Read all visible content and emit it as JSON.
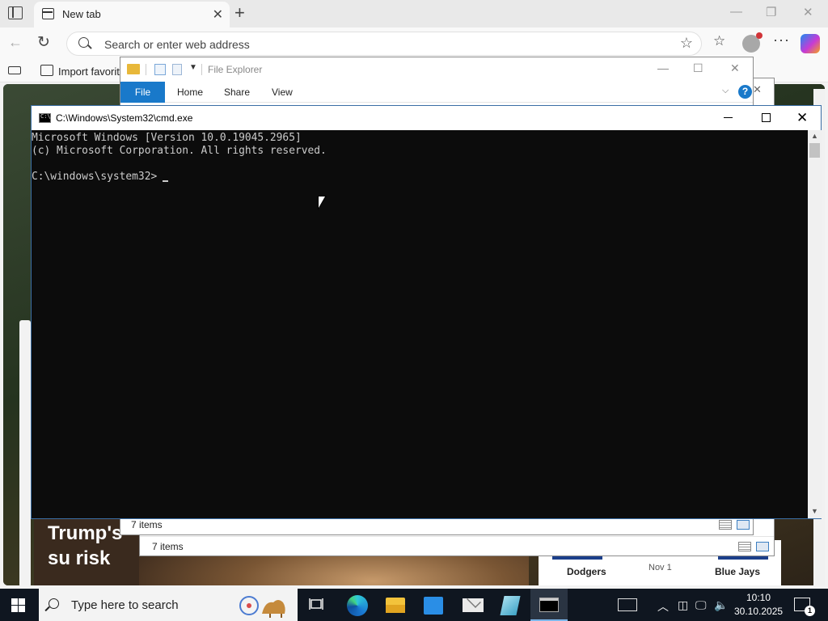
{
  "browser": {
    "tab_title": "New tab",
    "tab_close": "✕",
    "new_tab": "+",
    "window_controls": {
      "minimize": "—",
      "restore": "❐",
      "close": "✕"
    },
    "nav": {
      "back": "←",
      "refresh": "↻",
      "more": "···"
    },
    "address_placeholder": "Search or enter web address",
    "favorites_bar": {
      "import_label": "Import favorite"
    },
    "news": {
      "headline": "Trump's su risk"
    },
    "sports": {
      "team_left": "Dodgers",
      "date": "Nov 1",
      "team_right": "Blue Jays"
    },
    "icons": [
      "tab-actions-icon",
      "tab-favicon",
      "back-icon",
      "refresh-icon",
      "search-icon",
      "star-icon",
      "favorites-icon",
      "profile-icon",
      "more-icon",
      "copilot-icon"
    ]
  },
  "explorer_front": {
    "title": "File Explorer",
    "tabs": {
      "file": "File",
      "home": "Home",
      "share": "Share",
      "view": "View"
    },
    "help": "?",
    "status": "7 items",
    "controls": {
      "minimize": "—",
      "maximize": "☐",
      "close": "✕"
    }
  },
  "explorer_back": {
    "status": "7 items",
    "close": "✕"
  },
  "cmd": {
    "title": "C:\\Windows\\System32\\cmd.exe",
    "close": "✕",
    "lines": [
      "Microsoft Windows [Version 10.0.19045.2965]",
      "(c) Microsoft Corporation. All rights reserved.",
      "",
      "C:\\windows\\system32>"
    ],
    "scroll_up": "▲",
    "scroll_down": "▼"
  },
  "taskbar": {
    "search_placeholder": "Type here to search",
    "time": "10:10",
    "date": "30.10.2025",
    "notification_count": "1",
    "tray": {
      "chevron": "︿",
      "speaker": "🔈"
    },
    "colors": {
      "background": "#0f1620",
      "active_underline": "#7cb6ea"
    }
  }
}
